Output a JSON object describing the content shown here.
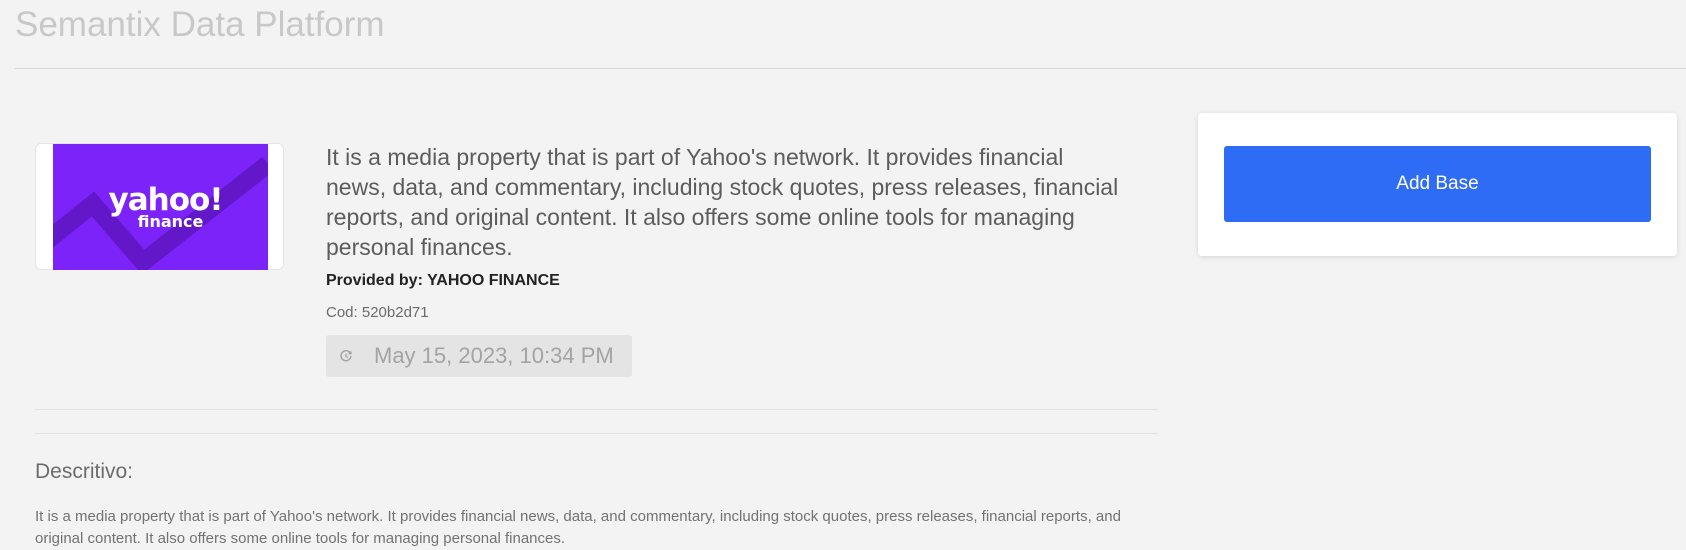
{
  "app": {
    "title": "Semantix Data Platform"
  },
  "dataset": {
    "logo": {
      "wordmark": "yahoo!",
      "sub": "finance",
      "background_color": "#7b23f8"
    },
    "summary": "It is a media property that is part of Yahoo's network. It provides financial news, data, and commentary, including stock quotes, press releases, financial reports, and original content. It also offers some online tools for managing personal finances.",
    "provider_label": "Provided by: YAHOO FINANCE",
    "code_label": "Cod: 520b2d71",
    "date": {
      "icon": "clock-icon",
      "text": "May 15, 2023, 10:34 PM"
    }
  },
  "description": {
    "heading": "Descritivo:",
    "body": "It is a media property that is part of Yahoo's network. It provides financial news, data, and commentary, including stock quotes, press releases, financial reports, and original content. It also offers some online tools for managing personal finances."
  },
  "actions": {
    "add_base_label": "Add Base",
    "accent_color": "#2f6cf6"
  }
}
